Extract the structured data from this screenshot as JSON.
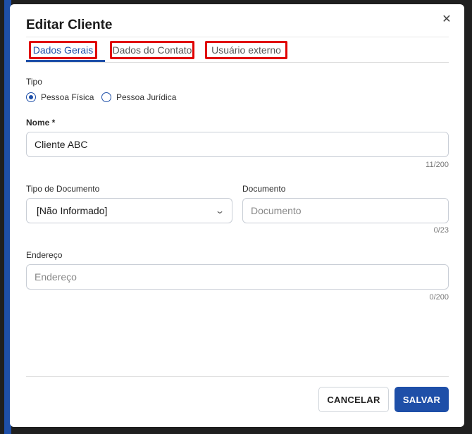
{
  "dialog": {
    "title": "Editar Cliente",
    "close_icon": "close-icon"
  },
  "tabs": [
    {
      "label": "Dados Gerais",
      "active": true
    },
    {
      "label": "Dados do Contato",
      "active": false
    },
    {
      "label": "Usuário externo",
      "active": false
    }
  ],
  "form": {
    "tipo": {
      "label": "Tipo",
      "options": [
        {
          "label": "Pessoa Física",
          "checked": true
        },
        {
          "label": "Pessoa Jurídica",
          "checked": false
        }
      ]
    },
    "nome": {
      "label": "Nome *",
      "value": "Cliente ABC",
      "counter": "11/200"
    },
    "tipo_documento": {
      "label": "Tipo de Documento",
      "value": "[Não Informado]"
    },
    "documento": {
      "label": "Documento",
      "value": "",
      "placeholder": "Documento",
      "counter": "0/23"
    },
    "endereco": {
      "label": "Endereço",
      "value": "",
      "placeholder": "Endereço",
      "counter": "0/200"
    }
  },
  "footer": {
    "cancel_label": "CANCELAR",
    "save_label": "SALVAR"
  },
  "colors": {
    "accent": "#1e4fa8",
    "highlight": "#e00000"
  }
}
